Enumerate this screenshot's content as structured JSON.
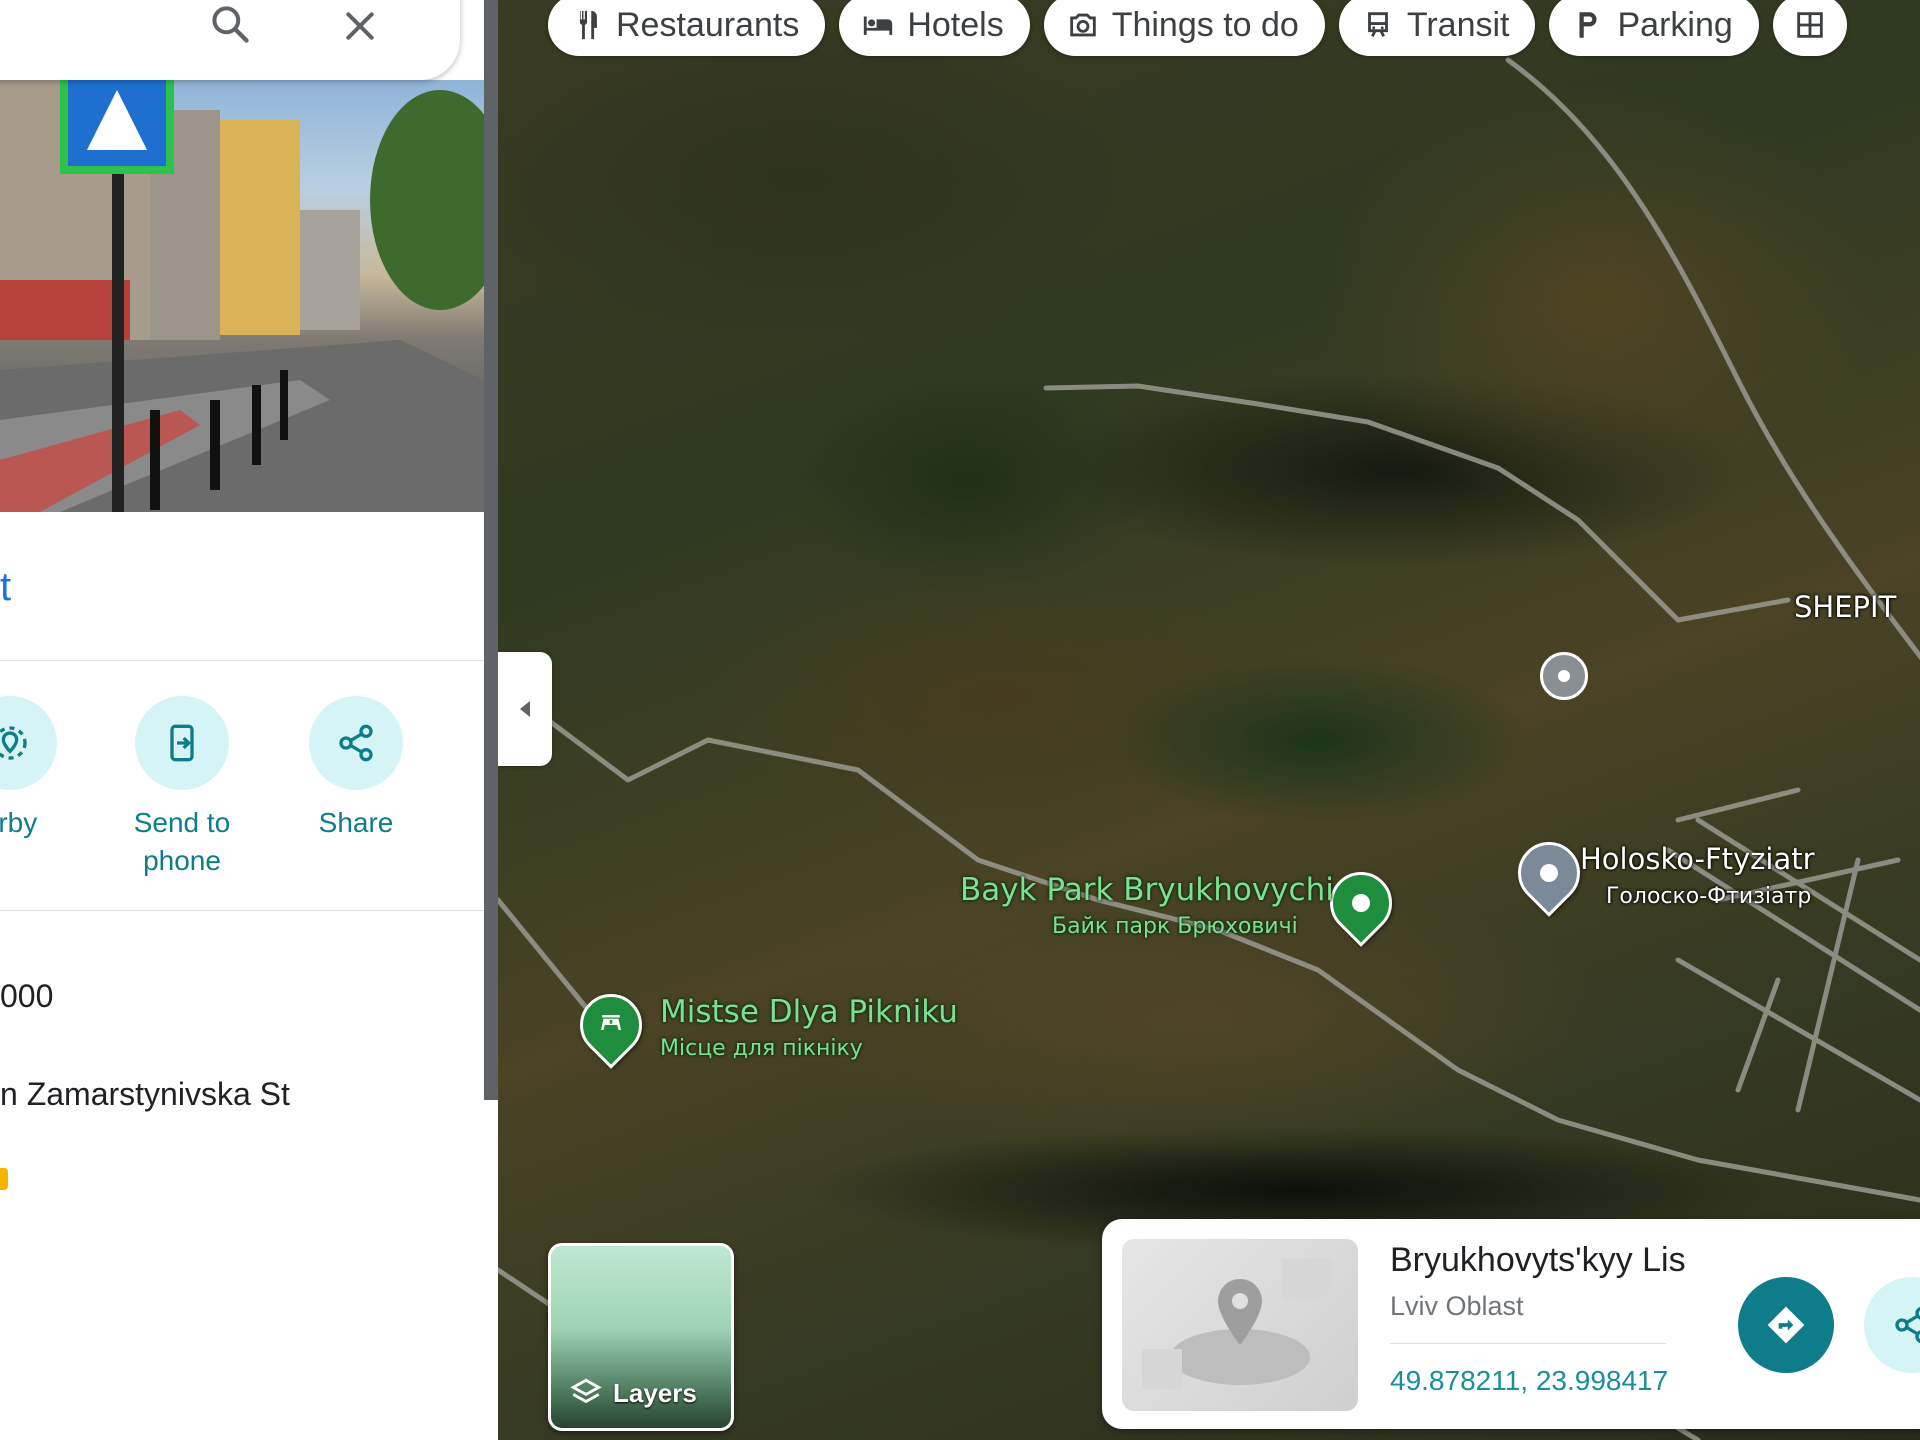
{
  "chips": [
    {
      "label": "Restaurants",
      "icon": "restaurant-icon"
    },
    {
      "label": "Hotels",
      "icon": "hotel-icon"
    },
    {
      "label": "Things to do",
      "icon": "camera-icon"
    },
    {
      "label": "Transit",
      "icon": "train-icon"
    },
    {
      "label": "Parking",
      "icon": "parking-icon"
    }
  ],
  "map": {
    "labels": {
      "shepit": "SHEPIT",
      "holosko_en": "Holosko-Ftyziatr",
      "holosko_uk": "Голоско-Фтизіатр",
      "bayk_en": "Bayk Park Bryukhovychi",
      "bayk_uk": "Байк парк Брюховичі",
      "mistse_en": "Mistse Dlya Pikniku",
      "mistse_uk": "Місце для пікніку"
    },
    "layers_label": "Layers"
  },
  "info_card": {
    "title": "Bryukhovyts'kyy Lis",
    "subtitle": "Lviv Oblast",
    "coords": "49.878211, 23.998417"
  },
  "panel": {
    "accent_text": "t",
    "actions": [
      {
        "label": "arby",
        "icon": "nearby-icon"
      },
      {
        "label": "Send to phone",
        "icon": "send-to-phone-icon"
      },
      {
        "label": "Share",
        "icon": "share-icon"
      }
    ],
    "row1": "000",
    "row2": "n Zamarstynivska St"
  },
  "colors": {
    "accent": "#0f7c8a",
    "action_bg": "#d5f4f6",
    "poi_green": "#7ee08f"
  }
}
